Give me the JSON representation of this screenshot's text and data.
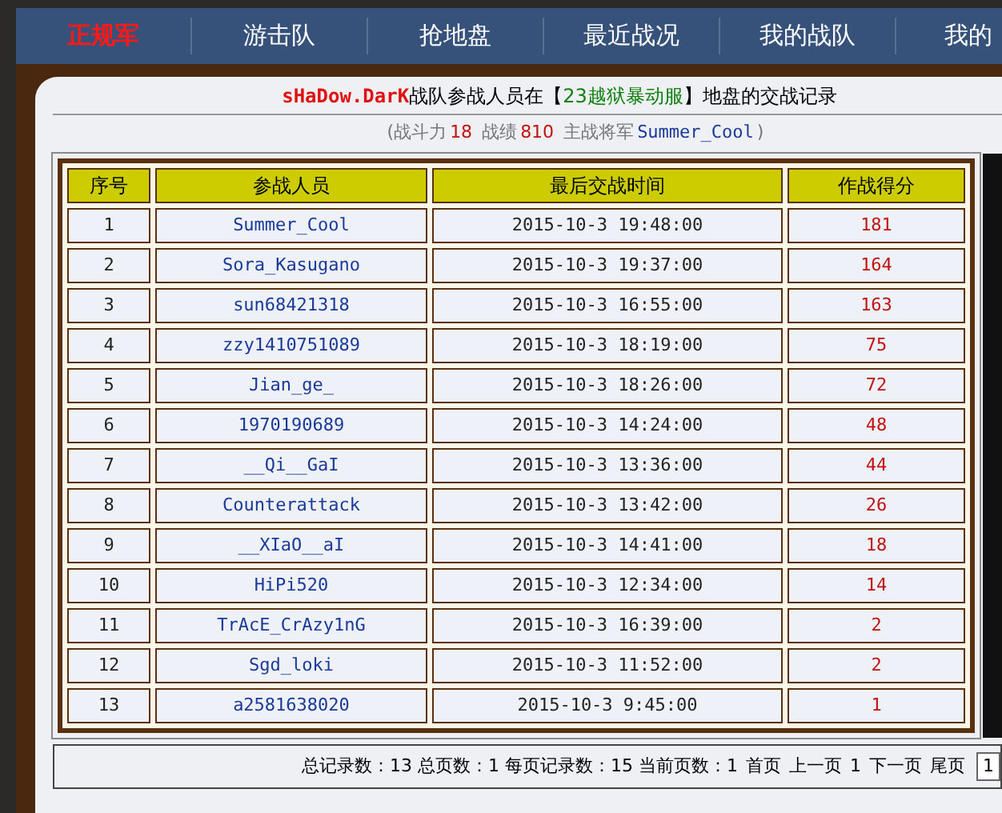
{
  "nav": [
    {
      "label": "正规军",
      "selected": true
    },
    {
      "label": "游击队",
      "selected": false
    },
    {
      "label": "抢地盘",
      "selected": false
    },
    {
      "label": "最近战况",
      "selected": false
    },
    {
      "label": "我的战队",
      "selected": false
    },
    {
      "label": "我的",
      "selected": false
    }
  ],
  "heading": {
    "team": "sHaDow.DarK",
    "text_1": "战队参战人员在【",
    "territory": "23越狱暴动服",
    "text_2": "】地盘的交战记录"
  },
  "stats": {
    "open": "(战斗力",
    "power": "18",
    "record_label": "战绩",
    "record": "810",
    "general_label": "主战将军",
    "general": "Summer_Cool",
    "close": ")"
  },
  "table": {
    "columns": [
      "序号",
      "参战人员",
      "最后交战时间",
      "作战得分"
    ],
    "rows": [
      [
        "1",
        "Summer_Cool",
        "2015-10-3 19:48:00",
        "181"
      ],
      [
        "2",
        "Sora_Kasugano",
        "2015-10-3 19:37:00",
        "164"
      ],
      [
        "3",
        "sun68421318",
        "2015-10-3 16:55:00",
        "163"
      ],
      [
        "4",
        "zzy1410751089",
        "2015-10-3 18:19:00",
        "75"
      ],
      [
        "5",
        "Jian_ge_",
        "2015-10-3 18:26:00",
        "72"
      ],
      [
        "6",
        "1970190689",
        "2015-10-3 14:24:00",
        "48"
      ],
      [
        "7",
        "__Qi__GaI",
        "2015-10-3 13:36:00",
        "44"
      ],
      [
        "8",
        "Counterattack",
        "2015-10-3 13:42:00",
        "26"
      ],
      [
        "9",
        "__XIaO__aI",
        "2015-10-3 14:41:00",
        "18"
      ],
      [
        "10",
        "HiPi520",
        "2015-10-3 12:34:00",
        "14"
      ],
      [
        "11",
        "TrAcE_CrAzy1nG",
        "2015-10-3 16:39:00",
        "2"
      ],
      [
        "12",
        "Sgd_loki",
        "2015-10-3 11:52:00",
        "2"
      ],
      [
        "13",
        "a2581638020",
        "2015-10-3 9:45:00",
        "1"
      ]
    ]
  },
  "pager": {
    "summary": "总记录数：13 总页数：1 每页记录数：15 当前页数：1",
    "links": [
      "首页",
      "上一页"
    ],
    "current": "1",
    "links_after": [
      "下一页",
      "尾页"
    ],
    "page_box": "1"
  }
}
